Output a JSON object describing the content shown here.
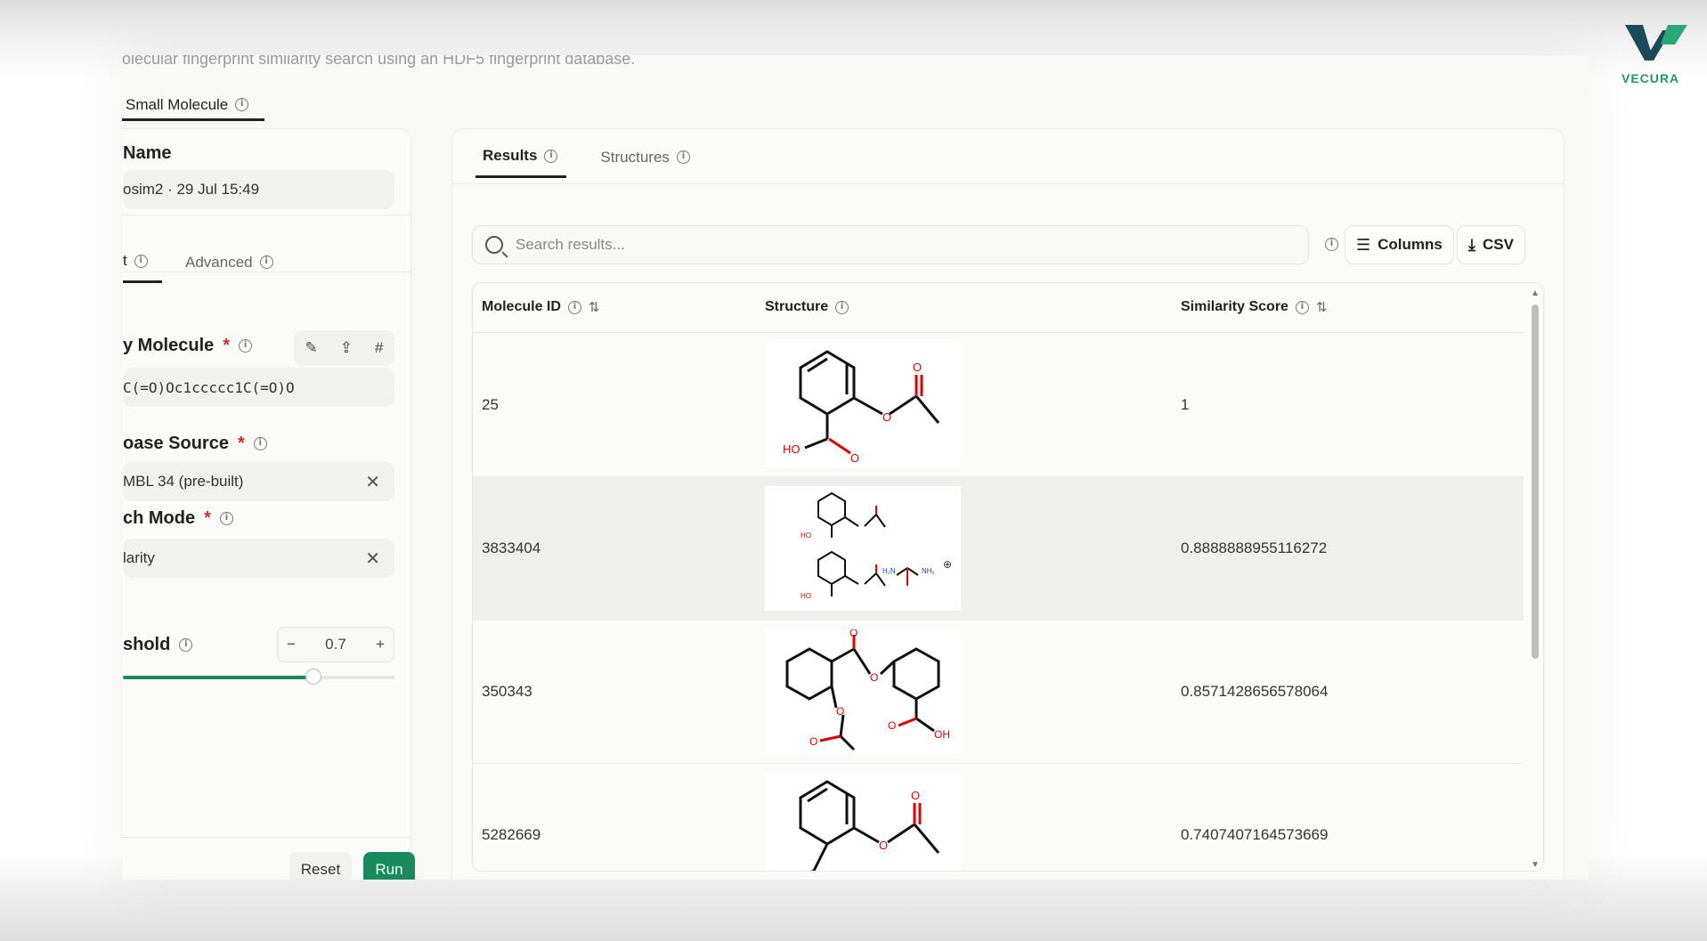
{
  "brand": {
    "name": "VECURA"
  },
  "header": {
    "subtitle": "olecular fingerprint similarity search using an HDF5 fingerprint database.",
    "tab_label": "Small Molecule"
  },
  "left": {
    "name_label": "Name",
    "name_value": "osim2 · 29 Jul 15:49",
    "subtabs": [
      "t",
      "Advanced"
    ],
    "query_label": "y Molecule",
    "query_value": "C(=O)Oc1ccccc1C(=O)O",
    "source_label": "oase Source",
    "source_value": "MBL 34 (pre-built)",
    "mode_label": "ch Mode",
    "mode_value": "larity",
    "threshold_label": "shold",
    "threshold_value": "0.7",
    "threshold_fraction": 0.7,
    "required_mark": "*",
    "reset_label": "Reset",
    "run_label": "Run"
  },
  "results": {
    "tabs": [
      "Results",
      "Structures"
    ],
    "search_placeholder": "Search results...",
    "columns_label": "Columns",
    "csv_label": "CSV",
    "headers": [
      "Molecule ID",
      "Structure",
      "Similarity Score"
    ],
    "rows": [
      {
        "id": "25",
        "score": "1"
      },
      {
        "id": "3833404",
        "score": "0.8888888955116272"
      },
      {
        "id": "350343",
        "score": "0.8571428656578064"
      },
      {
        "id": "5282669",
        "score": "0.7407407164573669"
      }
    ]
  },
  "colors": {
    "accent": "#188a5c",
    "required": "#d42a2a"
  }
}
